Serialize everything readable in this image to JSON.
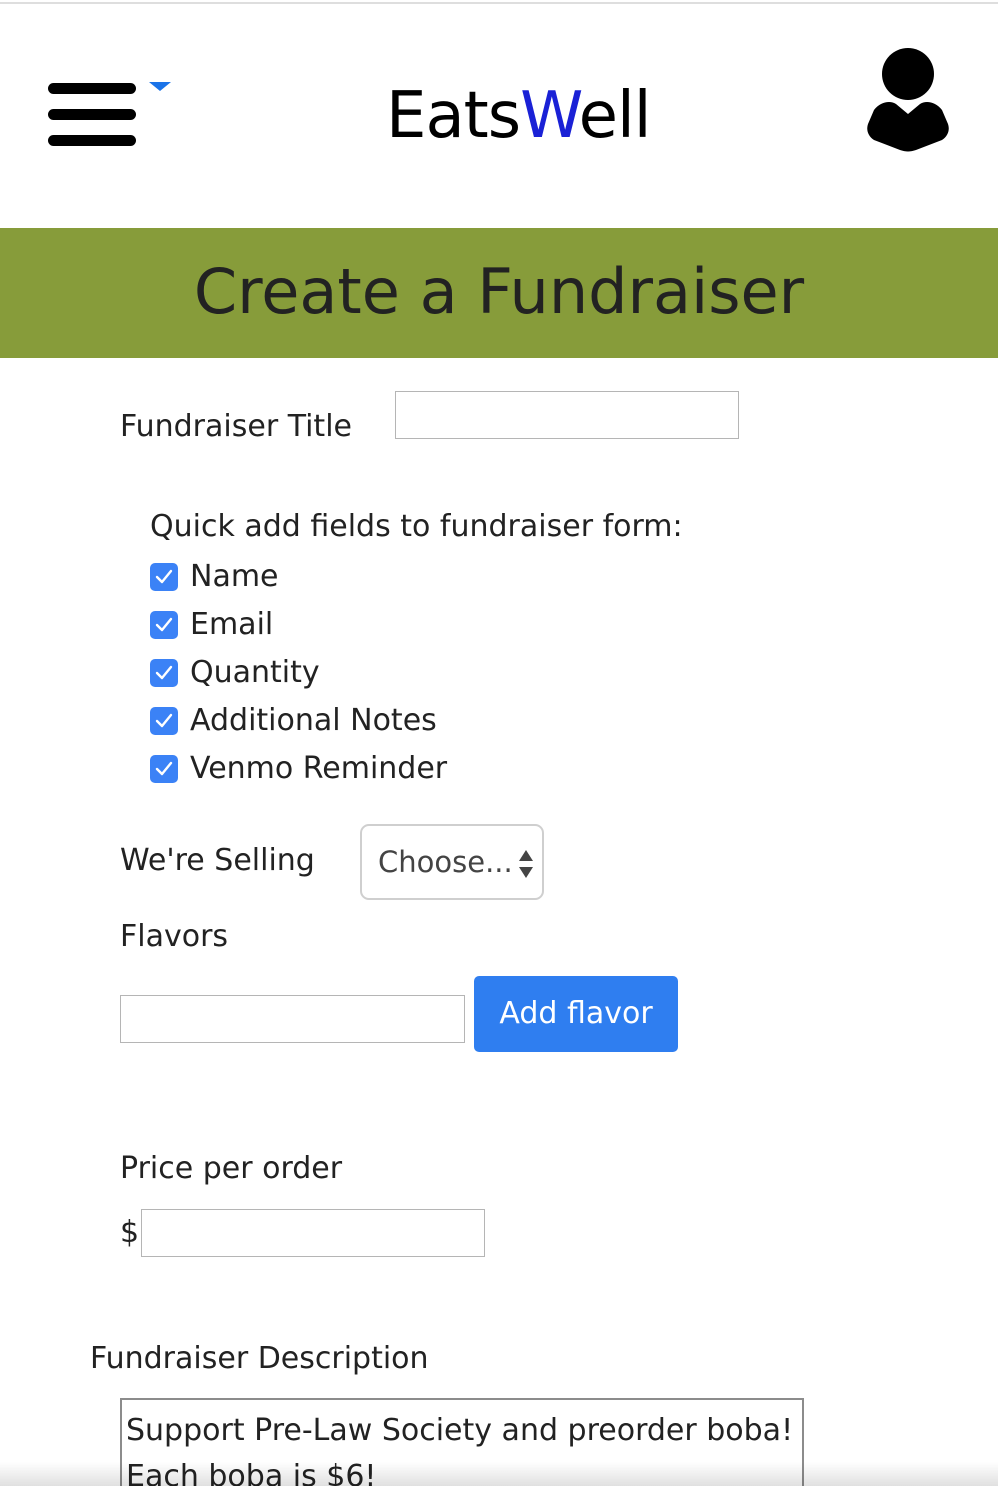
{
  "header": {
    "brand_prefix": "Eats",
    "brand_accent": "W",
    "brand_suffix": "ell",
    "brand_accent_color": "#1a21d6"
  },
  "banner": {
    "title": "Create a Fundraiser",
    "background_color": "#879c3a"
  },
  "form": {
    "title_label": "Fundraiser Title",
    "title_value": "",
    "quick_add_label": "Quick add fields to fundraiser form:",
    "quick_add_fields": [
      {
        "label": "Name",
        "checked": true
      },
      {
        "label": "Email",
        "checked": true
      },
      {
        "label": "Quantity",
        "checked": true
      },
      {
        "label": "Additional Notes",
        "checked": true
      },
      {
        "label": "Venmo Reminder",
        "checked": true
      }
    ],
    "selling_label": "We're Selling",
    "selling_value": "Choose...",
    "flavors_label": "Flavors",
    "flavor_value": "",
    "add_flavor_button": "Add flavor",
    "price_label": "Price per order",
    "currency_symbol": "$",
    "price_value": "",
    "description_label": "Fundraiser Description",
    "description_lines": [
      "Support Pre-Law Society and preorder boba!",
      "Each boba is $6!"
    ]
  },
  "icons": {
    "menu": "hamburger-menu-icon",
    "menu_caret": "caret-down-icon",
    "user": "user-icon",
    "checkbox": "checkmark-icon",
    "select_arrows": "select-arrows-icon"
  },
  "colors": {
    "checkbox": "#3b82f6",
    "button": "#2f7ef0",
    "caret": "#1a73e8"
  }
}
